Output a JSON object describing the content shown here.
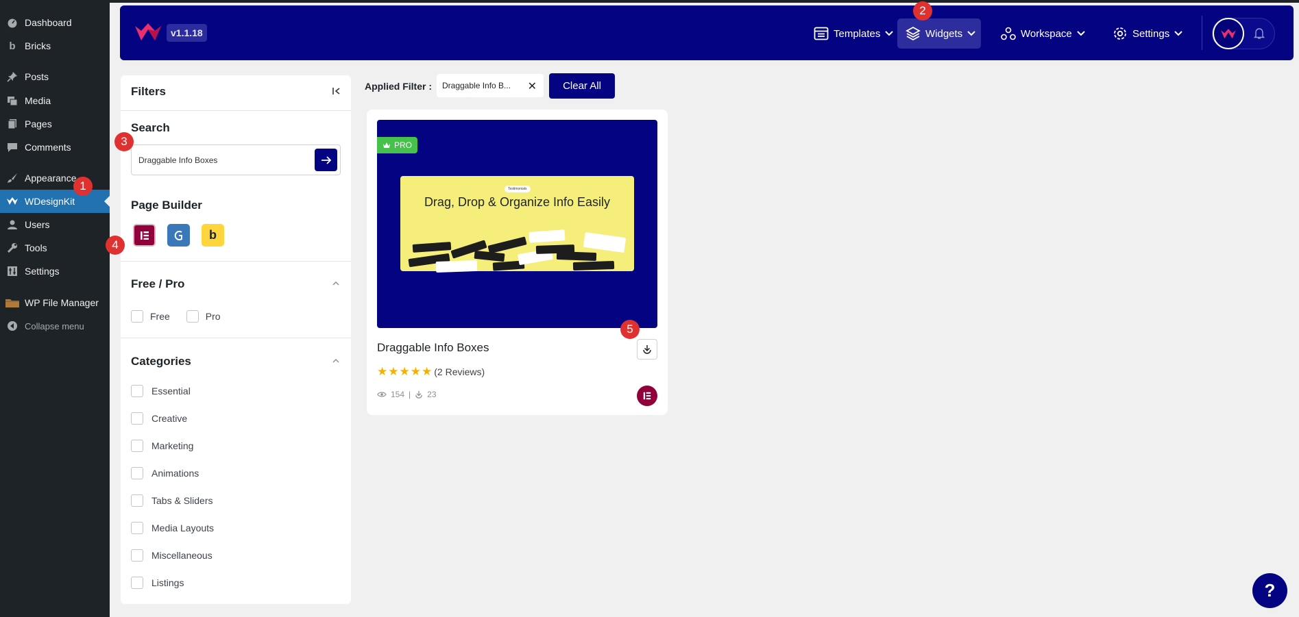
{
  "wp_sidebar": {
    "items": [
      {
        "label": "Dashboard",
        "icon": "dashboard-icon"
      },
      {
        "label": "Bricks",
        "icon": "bricks-icon"
      },
      {
        "label": "Posts",
        "icon": "pin-icon"
      },
      {
        "label": "Media",
        "icon": "media-icon"
      },
      {
        "label": "Pages",
        "icon": "pages-icon"
      },
      {
        "label": "Comments",
        "icon": "comment-icon"
      },
      {
        "label": "Appearance",
        "icon": "brush-icon"
      },
      {
        "label": "WDesignKit",
        "icon": "wdesignkit-icon"
      },
      {
        "label": "Users",
        "icon": "users-icon"
      },
      {
        "label": "Tools",
        "icon": "wrench-icon"
      },
      {
        "label": "Settings",
        "icon": "settings-icon"
      },
      {
        "label": "WP File Manager",
        "icon": "folder-icon"
      },
      {
        "label": "Collapse menu",
        "icon": "collapse-icon"
      }
    ]
  },
  "header": {
    "version": "v1.1.18",
    "nav": {
      "templates": "Templates",
      "widgets": "Widgets",
      "workspace": "Workspace",
      "settings": "Settings"
    }
  },
  "filters": {
    "title": "Filters",
    "search_heading": "Search",
    "search_value": "Draggable Info Boxes",
    "page_builder_heading": "Page Builder",
    "page_builders": [
      "elementor-icon",
      "gutenberg-icon",
      "bricks-icon"
    ],
    "bricks_letter": "b",
    "free_pro_heading": "Free / Pro",
    "free_label": "Free",
    "pro_label": "Pro",
    "categories_heading": "Categories",
    "categories": [
      "Essential",
      "Creative",
      "Marketing",
      "Animations",
      "Tabs & Sliders",
      "Media Layouts",
      "Miscellaneous",
      "Listings"
    ]
  },
  "applied": {
    "label": "Applied Filter :",
    "chip": "Draggable Info B...",
    "clear_all": "Clear All"
  },
  "card": {
    "badge": "PRO",
    "preview_title": "Drag, Drop & Organize Info Easily",
    "preview_tag": "Testimonials",
    "name": "Draggable Info Boxes",
    "rating": 5,
    "reviews": "(2 Reviews)",
    "views": "154",
    "downloads": "23"
  },
  "markers": [
    "1",
    "2",
    "3",
    "4",
    "5"
  ],
  "help_label": "?",
  "colors": {
    "brand": "#040483",
    "wp_sidebar": "#1d2327",
    "wp_active": "#2271b1",
    "pro": "#45c14c",
    "elementor": "#92003b",
    "marker": "#e03131"
  }
}
